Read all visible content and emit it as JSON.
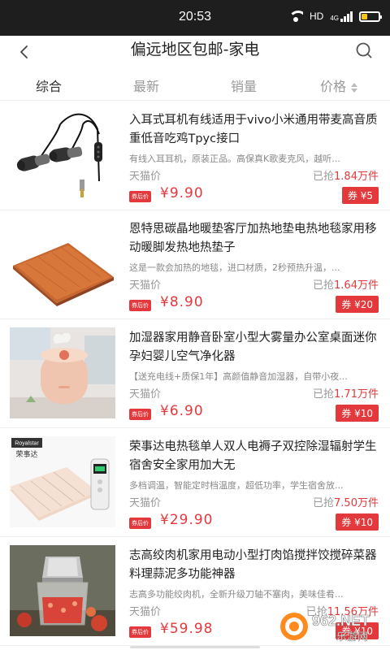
{
  "status_bar": {
    "time": "20:53",
    "network": "HD",
    "signal_label": "4G",
    "battery_level": 0.35,
    "battery_color": "#f5c518"
  },
  "header": {
    "title": "偏远地区包邮-家电",
    "back_icon": "chevron-left-icon",
    "search_icon": "search-icon"
  },
  "tabs": [
    {
      "label": "综合",
      "active": true
    },
    {
      "label": "最新",
      "active": false
    },
    {
      "label": "销量",
      "active": false
    },
    {
      "label": "价格",
      "active": false
    }
  ],
  "accent_color": "#e4393c",
  "products": [
    {
      "name": "入耳式耳机有线适用于vivo小米通用带麦高音质重低音吃鸡Tpyc接口",
      "desc": "有线入耳耳机，原装正品。高保真K歌麦克风，越听...",
      "platform": "天猫价",
      "sold_prefix": "已抢",
      "sold_num": "1.84",
      "sold_suffix": "万件",
      "badge": "券后价",
      "price": "¥9.90",
      "coupon": "券 ¥5",
      "image": "earphones"
    },
    {
      "name": "恩特思碳晶地暖垫客厅加热地垫电热地毯家用移动暖脚发热地热垫子",
      "desc": "这是一款会加热的地毯，进口材质，2秒预热升温，...",
      "platform": "天猫价",
      "sold_prefix": "已抢",
      "sold_num": "1.64",
      "sold_suffix": "万件",
      "badge": "券后价",
      "price": "¥8.90",
      "coupon": "券 ¥20",
      "image": "heating-mat"
    },
    {
      "name": "加湿器家用静音卧室小型大雾量办公室桌面迷你孕妇婴儿空气净化器",
      "desc": "【送充电线+质保1年】高颜值静音加湿器，自带小夜...",
      "platform": "天猫价",
      "sold_prefix": "已抢",
      "sold_num": "1.71",
      "sold_suffix": "万件",
      "badge": "券后价",
      "price": "¥6.90",
      "coupon": "券 ¥10",
      "image": "humidifier"
    },
    {
      "name": "荣事达电热毯单人双人电褥子双控除湿辐射学生宿舍安全家用加大无",
      "desc": "多档调温，智能定时档温度，超低功率，学生宿舍放...",
      "platform": "天猫价",
      "sold_prefix": "已抢",
      "sold_num": "7.50",
      "sold_suffix": "万件",
      "badge": "券后价",
      "price": "¥29.90",
      "coupon": "券 ¥10",
      "image": "electric-blanket",
      "brand_cn": "荣事达",
      "brand_en": "Royalstar"
    },
    {
      "name": "志高绞肉机家用电动小型打肉馅搅拌饺搅碎菜器料理蒜泥多功能神器",
      "desc": "志高多功能绞肉机，全新升级刀轴不塞肉，美味佳肴...",
      "platform": "天猫价",
      "sold_prefix": "已抢",
      "sold_num": "11.56",
      "sold_suffix": "万件",
      "badge": "券后价",
      "price": "¥59.98",
      "coupon": "券 ¥10",
      "image": "meat-grinder"
    }
  ],
  "watermark": {
    "site": "962.NET",
    "name": "乐游网"
  }
}
